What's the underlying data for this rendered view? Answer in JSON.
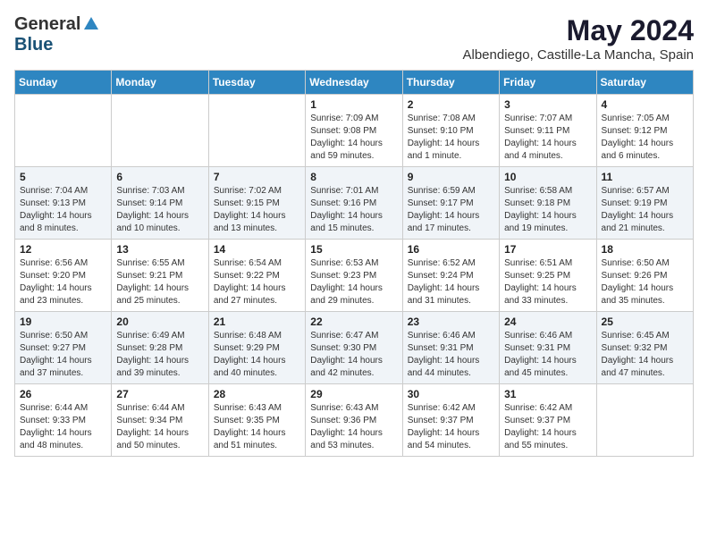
{
  "header": {
    "logo_general": "General",
    "logo_blue": "Blue",
    "month_title": "May 2024",
    "location": "Albendiego, Castille-La Mancha, Spain"
  },
  "weekdays": [
    "Sunday",
    "Monday",
    "Tuesday",
    "Wednesday",
    "Thursday",
    "Friday",
    "Saturday"
  ],
  "weeks": [
    [
      {
        "day": "",
        "sunrise": "",
        "sunset": "",
        "daylight": ""
      },
      {
        "day": "",
        "sunrise": "",
        "sunset": "",
        "daylight": ""
      },
      {
        "day": "",
        "sunrise": "",
        "sunset": "",
        "daylight": ""
      },
      {
        "day": "1",
        "sunrise": "Sunrise: 7:09 AM",
        "sunset": "Sunset: 9:08 PM",
        "daylight": "Daylight: 14 hours and 59 minutes."
      },
      {
        "day": "2",
        "sunrise": "Sunrise: 7:08 AM",
        "sunset": "Sunset: 9:10 PM",
        "daylight": "Daylight: 14 hours and 1 minute."
      },
      {
        "day": "3",
        "sunrise": "Sunrise: 7:07 AM",
        "sunset": "Sunset: 9:11 PM",
        "daylight": "Daylight: 14 hours and 4 minutes."
      },
      {
        "day": "4",
        "sunrise": "Sunrise: 7:05 AM",
        "sunset": "Sunset: 9:12 PM",
        "daylight": "Daylight: 14 hours and 6 minutes."
      }
    ],
    [
      {
        "day": "5",
        "sunrise": "Sunrise: 7:04 AM",
        "sunset": "Sunset: 9:13 PM",
        "daylight": "Daylight: 14 hours and 8 minutes."
      },
      {
        "day": "6",
        "sunrise": "Sunrise: 7:03 AM",
        "sunset": "Sunset: 9:14 PM",
        "daylight": "Daylight: 14 hours and 10 minutes."
      },
      {
        "day": "7",
        "sunrise": "Sunrise: 7:02 AM",
        "sunset": "Sunset: 9:15 PM",
        "daylight": "Daylight: 14 hours and 13 minutes."
      },
      {
        "day": "8",
        "sunrise": "Sunrise: 7:01 AM",
        "sunset": "Sunset: 9:16 PM",
        "daylight": "Daylight: 14 hours and 15 minutes."
      },
      {
        "day": "9",
        "sunrise": "Sunrise: 6:59 AM",
        "sunset": "Sunset: 9:17 PM",
        "daylight": "Daylight: 14 hours and 17 minutes."
      },
      {
        "day": "10",
        "sunrise": "Sunrise: 6:58 AM",
        "sunset": "Sunset: 9:18 PM",
        "daylight": "Daylight: 14 hours and 19 minutes."
      },
      {
        "day": "11",
        "sunrise": "Sunrise: 6:57 AM",
        "sunset": "Sunset: 9:19 PM",
        "daylight": "Daylight: 14 hours and 21 minutes."
      }
    ],
    [
      {
        "day": "12",
        "sunrise": "Sunrise: 6:56 AM",
        "sunset": "Sunset: 9:20 PM",
        "daylight": "Daylight: 14 hours and 23 minutes."
      },
      {
        "day": "13",
        "sunrise": "Sunrise: 6:55 AM",
        "sunset": "Sunset: 9:21 PM",
        "daylight": "Daylight: 14 hours and 25 minutes."
      },
      {
        "day": "14",
        "sunrise": "Sunrise: 6:54 AM",
        "sunset": "Sunset: 9:22 PM",
        "daylight": "Daylight: 14 hours and 27 minutes."
      },
      {
        "day": "15",
        "sunrise": "Sunrise: 6:53 AM",
        "sunset": "Sunset: 9:23 PM",
        "daylight": "Daylight: 14 hours and 29 minutes."
      },
      {
        "day": "16",
        "sunrise": "Sunrise: 6:52 AM",
        "sunset": "Sunset: 9:24 PM",
        "daylight": "Daylight: 14 hours and 31 minutes."
      },
      {
        "day": "17",
        "sunrise": "Sunrise: 6:51 AM",
        "sunset": "Sunset: 9:25 PM",
        "daylight": "Daylight: 14 hours and 33 minutes."
      },
      {
        "day": "18",
        "sunrise": "Sunrise: 6:50 AM",
        "sunset": "Sunset: 9:26 PM",
        "daylight": "Daylight: 14 hours and 35 minutes."
      }
    ],
    [
      {
        "day": "19",
        "sunrise": "Sunrise: 6:50 AM",
        "sunset": "Sunset: 9:27 PM",
        "daylight": "Daylight: 14 hours and 37 minutes."
      },
      {
        "day": "20",
        "sunrise": "Sunrise: 6:49 AM",
        "sunset": "Sunset: 9:28 PM",
        "daylight": "Daylight: 14 hours and 39 minutes."
      },
      {
        "day": "21",
        "sunrise": "Sunrise: 6:48 AM",
        "sunset": "Sunset: 9:29 PM",
        "daylight": "Daylight: 14 hours and 40 minutes."
      },
      {
        "day": "22",
        "sunrise": "Sunrise: 6:47 AM",
        "sunset": "Sunset: 9:30 PM",
        "daylight": "Daylight: 14 hours and 42 minutes."
      },
      {
        "day": "23",
        "sunrise": "Sunrise: 6:46 AM",
        "sunset": "Sunset: 9:31 PM",
        "daylight": "Daylight: 14 hours and 44 minutes."
      },
      {
        "day": "24",
        "sunrise": "Sunrise: 6:46 AM",
        "sunset": "Sunset: 9:31 PM",
        "daylight": "Daylight: 14 hours and 45 minutes."
      },
      {
        "day": "25",
        "sunrise": "Sunrise: 6:45 AM",
        "sunset": "Sunset: 9:32 PM",
        "daylight": "Daylight: 14 hours and 47 minutes."
      }
    ],
    [
      {
        "day": "26",
        "sunrise": "Sunrise: 6:44 AM",
        "sunset": "Sunset: 9:33 PM",
        "daylight": "Daylight: 14 hours and 48 minutes."
      },
      {
        "day": "27",
        "sunrise": "Sunrise: 6:44 AM",
        "sunset": "Sunset: 9:34 PM",
        "daylight": "Daylight: 14 hours and 50 minutes."
      },
      {
        "day": "28",
        "sunrise": "Sunrise: 6:43 AM",
        "sunset": "Sunset: 9:35 PM",
        "daylight": "Daylight: 14 hours and 51 minutes."
      },
      {
        "day": "29",
        "sunrise": "Sunrise: 6:43 AM",
        "sunset": "Sunset: 9:36 PM",
        "daylight": "Daylight: 14 hours and 53 minutes."
      },
      {
        "day": "30",
        "sunrise": "Sunrise: 6:42 AM",
        "sunset": "Sunset: 9:37 PM",
        "daylight": "Daylight: 14 hours and 54 minutes."
      },
      {
        "day": "31",
        "sunrise": "Sunrise: 6:42 AM",
        "sunset": "Sunset: 9:37 PM",
        "daylight": "Daylight: 14 hours and 55 minutes."
      },
      {
        "day": "",
        "sunrise": "",
        "sunset": "",
        "daylight": ""
      }
    ]
  ]
}
